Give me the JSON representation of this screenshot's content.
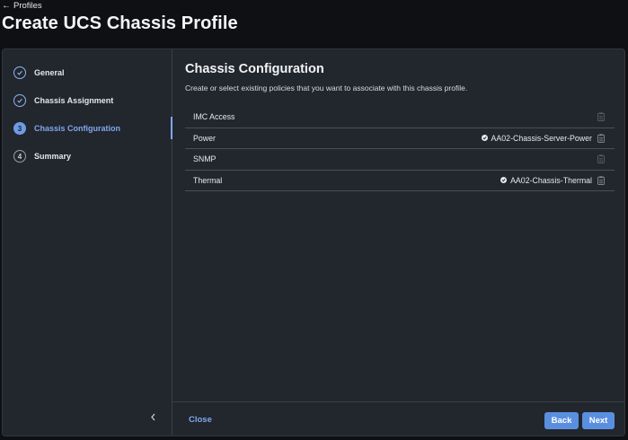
{
  "header": {
    "back_label": "Profiles",
    "title": "Create UCS Chassis Profile"
  },
  "steps": [
    {
      "label": "General",
      "state": "done",
      "marker": ""
    },
    {
      "label": "Chassis Assignment",
      "state": "done",
      "marker": ""
    },
    {
      "label": "Chassis Configuration",
      "state": "active",
      "marker": "3"
    },
    {
      "label": "Summary",
      "state": "pending",
      "marker": "4"
    }
  ],
  "main": {
    "title": "Chassis Configuration",
    "description": "Create or select existing policies that you want to associate with this chassis profile.",
    "policies": [
      {
        "name": "IMC Access",
        "value": ""
      },
      {
        "name": "Power",
        "value": "AA02-Chassis-Server-Power"
      },
      {
        "name": "SNMP",
        "value": ""
      },
      {
        "name": "Thermal",
        "value": "AA02-Chassis-Thermal"
      }
    ]
  },
  "footer": {
    "close_label": "Close",
    "back_label": "Back",
    "next_label": "Next"
  },
  "colors": {
    "accent": "#7fa7ee",
    "button": "#5a8fe0",
    "panel": "#22262d",
    "background": "#0e1014"
  },
  "icons": {
    "back": "arrow-left-icon",
    "done_step": "check-circle-icon",
    "collapse": "chevron-left-icon",
    "policy_status": "check-circle-icon",
    "policy_action": "clipboard-icon"
  }
}
